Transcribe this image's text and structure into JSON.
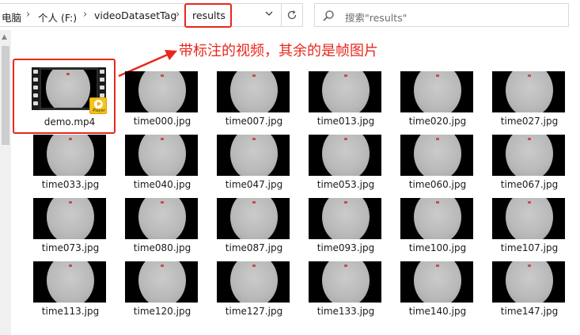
{
  "address_bar": {
    "crumbs": [
      "电脑",
      "个人 (F:)",
      "videoDatasetTag",
      "results"
    ],
    "separator": "›",
    "dropdown_icon": "chevron-down-icon",
    "refresh_icon": "refresh-icon"
  },
  "search": {
    "placeholder": "搜索\"results\"",
    "icon": "search-icon"
  },
  "annotation": {
    "text": "带标注的视频，其余的是帧图片",
    "color": "#e8271d"
  },
  "video": {
    "name": "demo.mp4",
    "badge_text": "Player"
  },
  "files": [
    "time000.jpg",
    "time007.jpg",
    "time013.jpg",
    "time020.jpg",
    "time027.jpg",
    "time033.jpg",
    "time040.jpg",
    "time047.jpg",
    "time053.jpg",
    "time060.jpg",
    "time067.jpg",
    "time073.jpg",
    "time080.jpg",
    "time087.jpg",
    "time093.jpg",
    "time100.jpg",
    "time107.jpg",
    "time113.jpg",
    "time120.jpg",
    "time127.jpg",
    "time133.jpg",
    "time140.jpg",
    "time147.jpg"
  ]
}
